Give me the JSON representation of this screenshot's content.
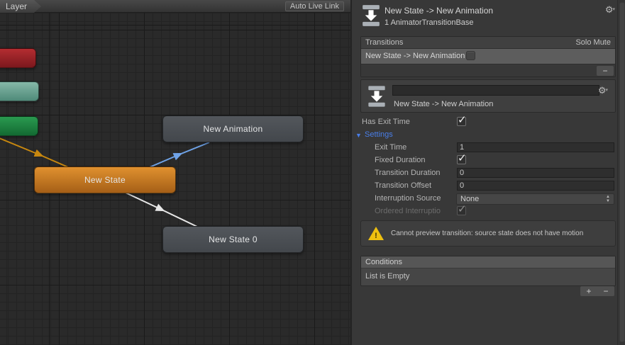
{
  "graph": {
    "toolbar": {
      "breadcrumb": "Layer",
      "auto_live_link": "Auto Live Link"
    },
    "nodes": [
      {
        "id": "red-state",
        "label": ""
      },
      {
        "id": "teal-state",
        "label": ""
      },
      {
        "id": "green-state",
        "label": ""
      },
      {
        "id": "new-animation",
        "label": "New Animation"
      },
      {
        "id": "new-state",
        "label": "New State"
      },
      {
        "id": "new-state-0",
        "label": "New State 0"
      }
    ],
    "colors": {
      "default_state_orange": "#c87a1e",
      "node_gray": "#4b4f54",
      "node_red": "#a0252b",
      "node_teal": "#6aa392",
      "node_green": "#1f8a46",
      "edge_selected_blue": "#6fa3e8",
      "edge_white": "#e8e8e8",
      "edge_entry_yellow": "#c8880f",
      "grid_background": "#2a2a2a"
    }
  },
  "inspector": {
    "header": {
      "title": "New State -> New Animation",
      "subtitle": "1 AnimatorTransitionBase"
    },
    "transitions": {
      "title": "Transitions",
      "solo_label": "Solo",
      "mute_label": "Mute",
      "rows": [
        {
          "label": "New State -> New Animation",
          "solo": false,
          "mute": false
        }
      ]
    },
    "detail": {
      "name_value": "",
      "label": "New State -> New Animation"
    },
    "fields": {
      "has_exit_time": {
        "label": "Has Exit Time",
        "checked": true
      },
      "settings": {
        "label": "Settings",
        "color": "#497ee8"
      },
      "exit_time": {
        "label": "Exit Time",
        "value": "1"
      },
      "fixed_duration": {
        "label": "Fixed Duration",
        "checked": true
      },
      "transition_duration": {
        "label": "Transition Duration",
        "value": "0"
      },
      "transition_offset": {
        "label": "Transition Offset",
        "value": "0"
      },
      "interruption_source": {
        "label": "Interruption Source",
        "value": "None"
      },
      "ordered_interruption": {
        "label": "Ordered Interruptio",
        "checked": true,
        "disabled": true
      }
    },
    "warning": {
      "text": "Cannot preview transition: source state does not have motion",
      "color": "#eec010"
    },
    "conditions": {
      "title": "Conditions",
      "empty_text": "List is Empty"
    }
  },
  "glyphs": {
    "check": "✓",
    "gear": "⚙",
    "minus": "−",
    "plus": "+",
    "foldout_open": "▼",
    "warning": "!",
    "dd_up": "▲",
    "dd_down": "▼"
  }
}
